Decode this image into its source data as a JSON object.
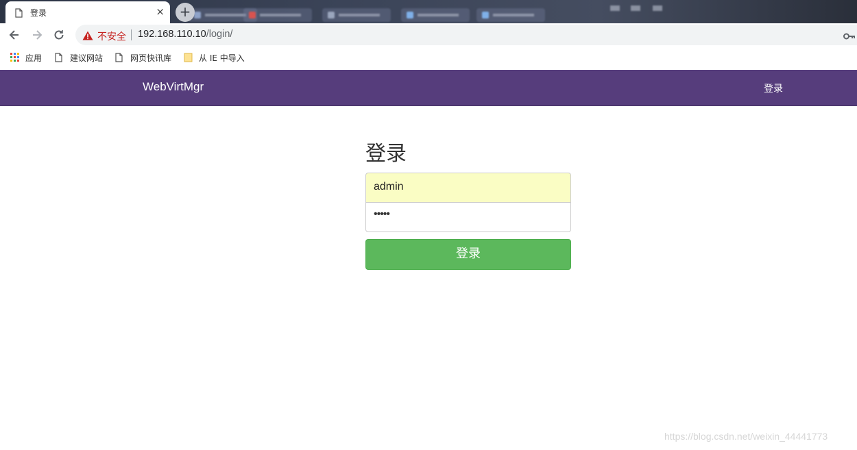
{
  "browser": {
    "tab_title": "登录",
    "tab_close": "×",
    "new_tab": "+",
    "security_label": "不安全",
    "url_host": "192.168.110.10",
    "url_path": "/login/"
  },
  "bookmarks": [
    {
      "label": "应用",
      "icon": "apps-grid-icon"
    },
    {
      "label": "建议网站",
      "icon": "page-icon"
    },
    {
      "label": "网页快讯库",
      "icon": "page-icon"
    },
    {
      "label": "从 IE 中导入",
      "icon": "folder-icon"
    }
  ],
  "navbar": {
    "brand": "WebVirtMgr",
    "login_link": "登录",
    "color": "#563d7c"
  },
  "login_form": {
    "title": "登录",
    "username_value": "admin",
    "password_value": "•••••",
    "submit_label": "登录",
    "button_color": "#5cb85c"
  },
  "watermark": "https://blog.csdn.net/weixin_44441773"
}
